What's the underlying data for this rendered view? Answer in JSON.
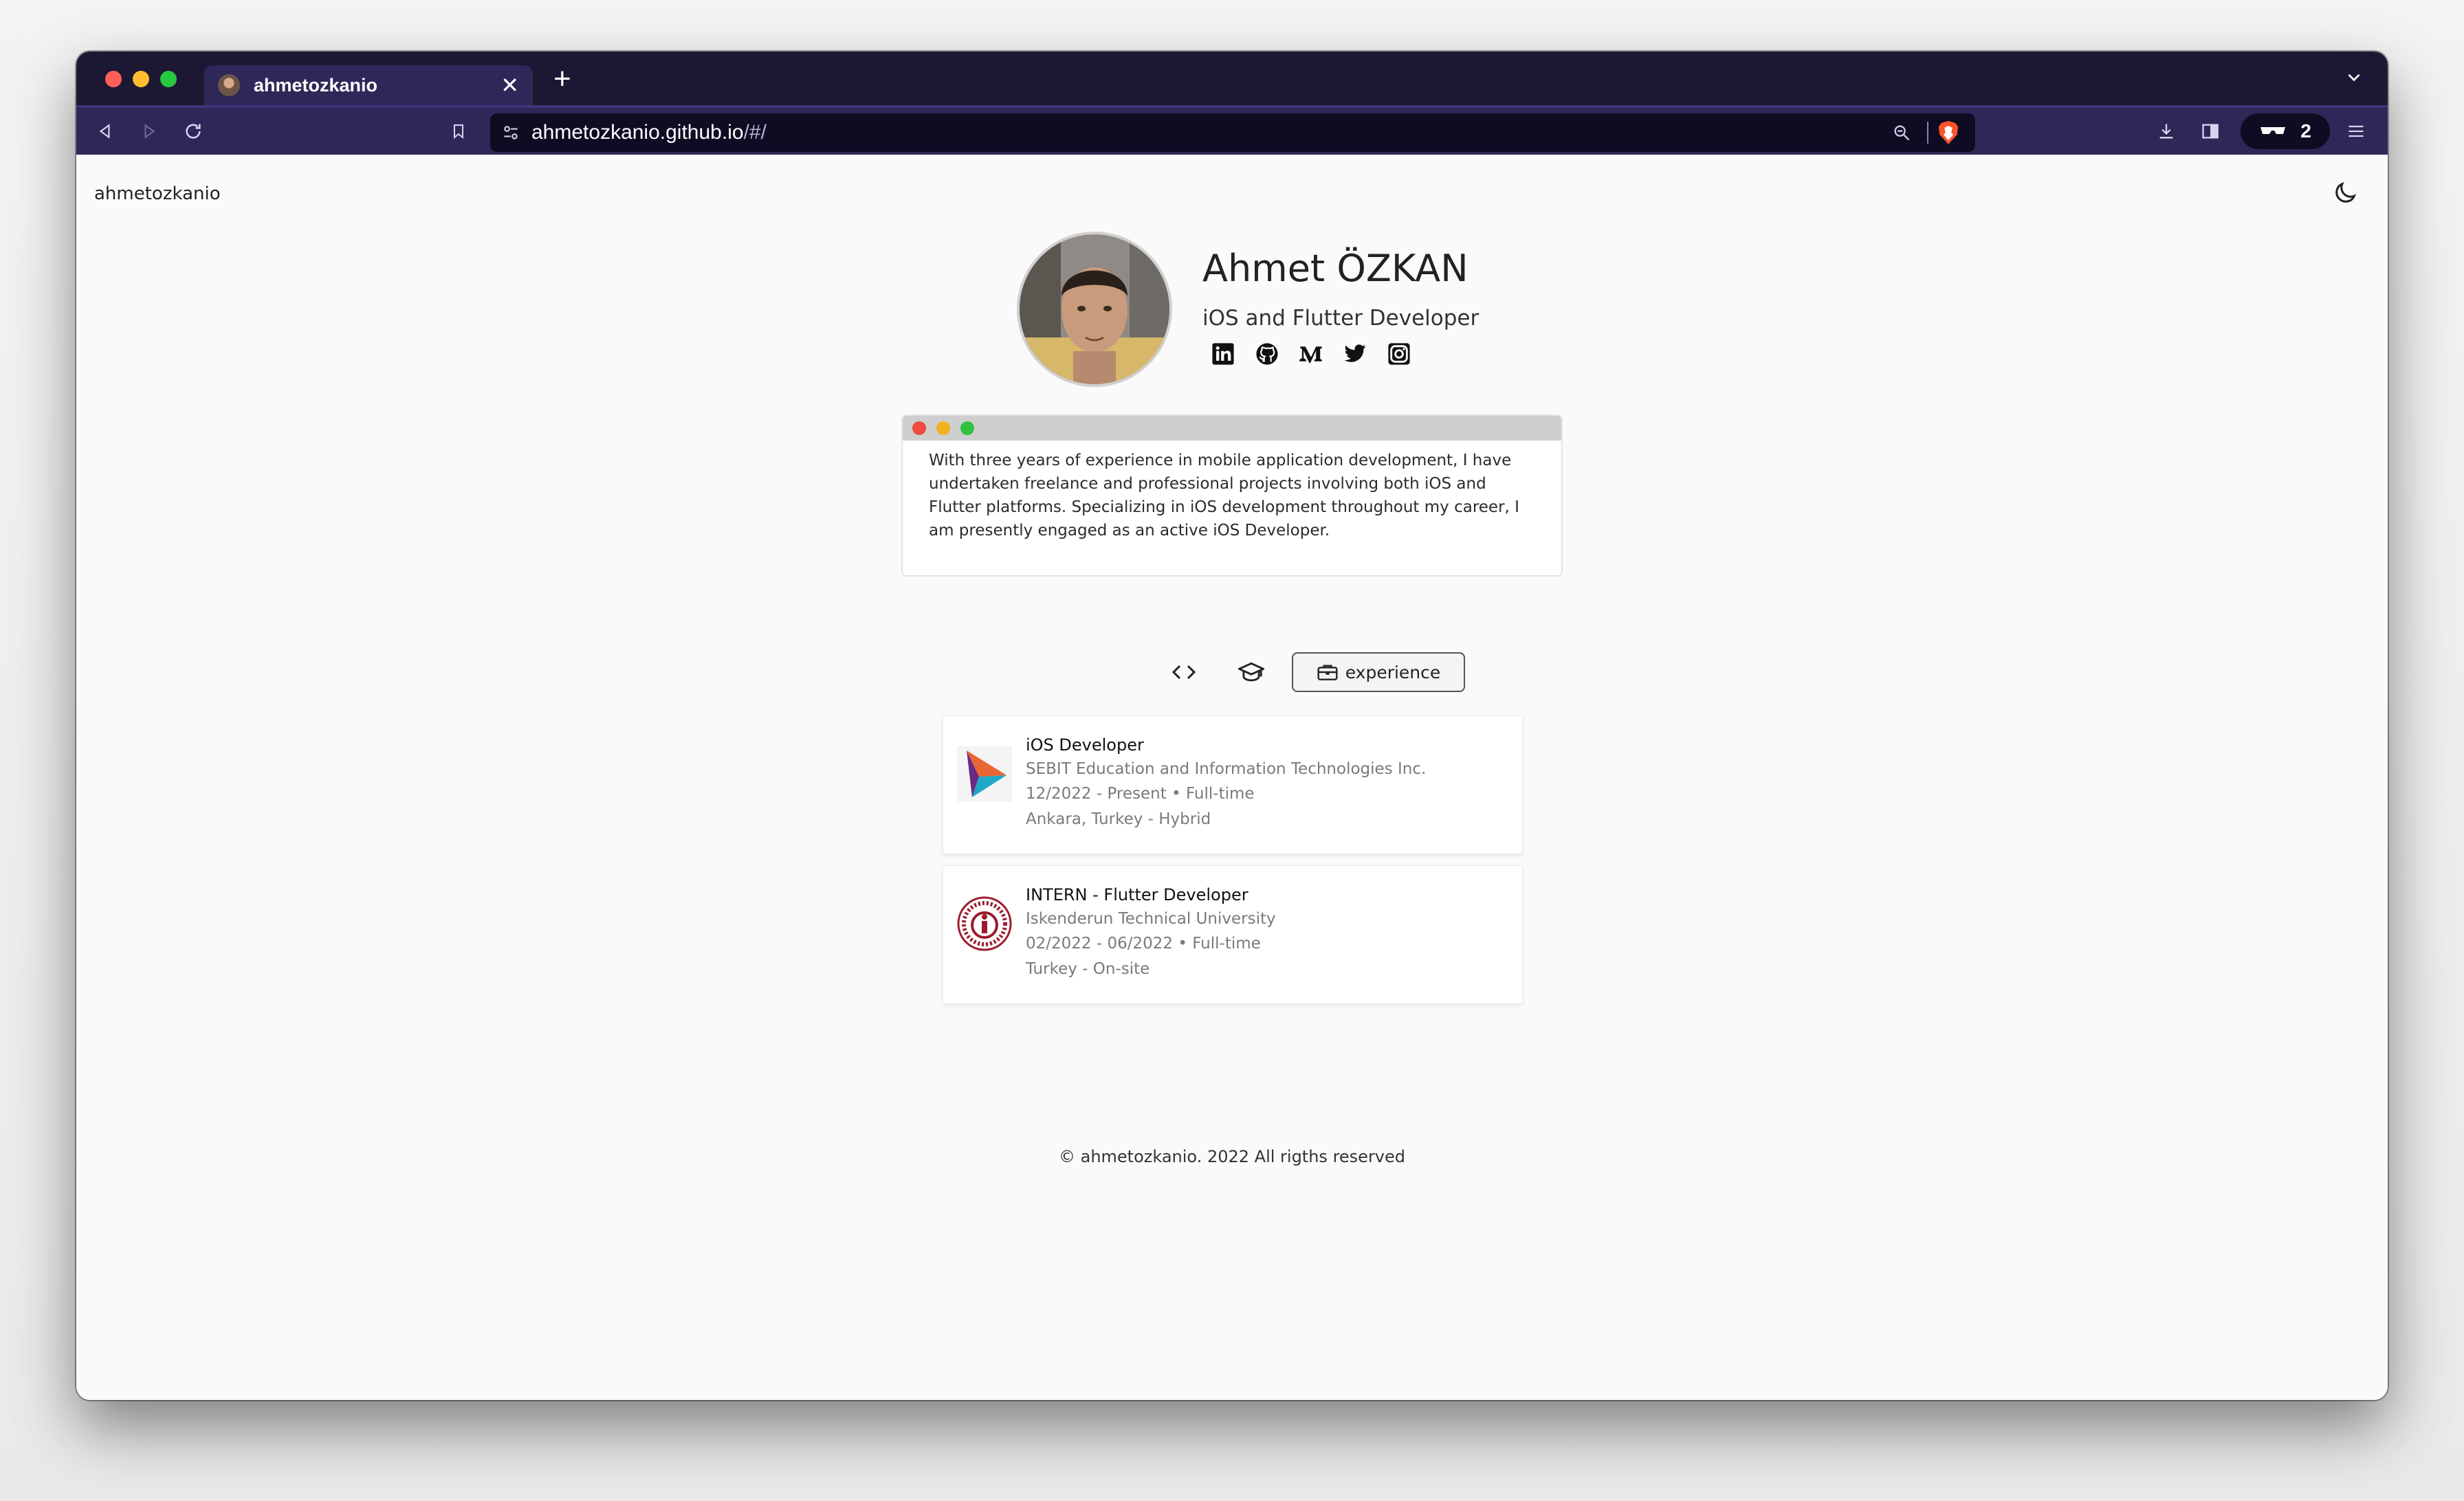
{
  "browser": {
    "tab_title": "ahmetozkanio",
    "url_host": "ahmetozkanio.github.io",
    "url_path": "/#/",
    "shields_count": "2",
    "colors": {
      "tabstrip": "#1c1834",
      "toolbar": "#2e2758",
      "urlbar": "#0e0b22"
    },
    "icons": [
      "back-icon",
      "forward-icon",
      "reload-icon",
      "bookmark-icon",
      "site-settings-icon",
      "zoom-icon",
      "brave-shields-icon",
      "download-icon",
      "sidebar-icon",
      "vpn-icon",
      "menu-icon"
    ]
  },
  "site": {
    "brand": "ahmetozkanio",
    "name": "Ahmet ÖZKAN",
    "role": "iOS and Flutter Developer",
    "socials": [
      "linkedin-icon",
      "github-icon",
      "medium-icon",
      "twitter-icon",
      "instagram-icon"
    ],
    "about": "With three years of experience in mobile application development, I have undertaken freelance and professional projects involving both iOS and Flutter platforms. Specializing in iOS development throughout my career, I am presently engaged as an active iOS Developer.",
    "tabs": {
      "active_label": "experience"
    },
    "experience": [
      {
        "title": "iOS Developer",
        "company": "SEBIT Education and Information Technologies Inc.",
        "period": "12/2022 - Present •  Full-time",
        "location": "Ankara, Turkey - Hybrid"
      },
      {
        "title": "INTERN - Flutter Developer",
        "company": "Iskenderun Technical University",
        "period": "02/2022 - 06/2022 •  Full-time",
        "location": "Turkey - On-site"
      }
    ],
    "footer": "© ahmetozkanio. 2022 All rigths reserved"
  }
}
